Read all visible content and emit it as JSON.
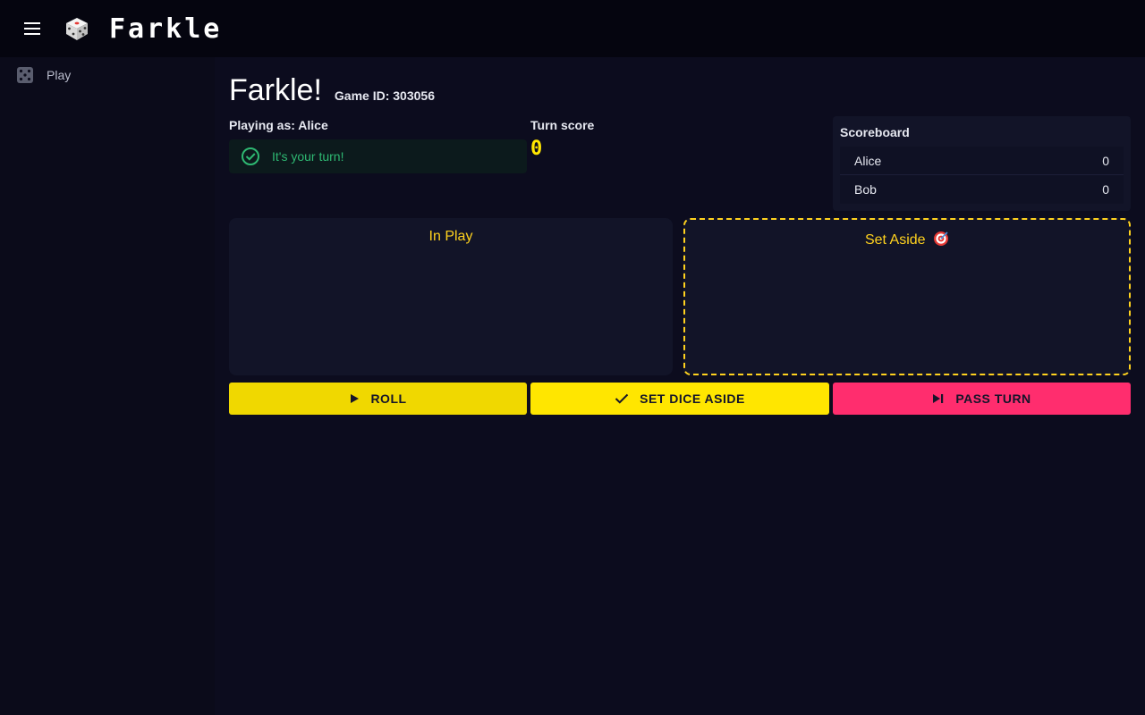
{
  "app": {
    "title": "Farkle",
    "logo_icon": "dice-icon",
    "menu_icon": "hamburger-menu-icon"
  },
  "sidebar": {
    "items": [
      {
        "label": "Play",
        "icon": "dice-five-icon"
      }
    ]
  },
  "game": {
    "title": "Farkle!",
    "game_id_label": "Game ID: 303056",
    "playing_as_prefix": "Playing as: ",
    "player_name": "Alice",
    "turn_message": "It's your turn!",
    "turn_score_label": "Turn score",
    "turn_score_value": "0"
  },
  "scoreboard": {
    "title": "Scoreboard",
    "rows": [
      {
        "name": "Alice",
        "score": "0"
      },
      {
        "name": "Bob",
        "score": "0"
      }
    ]
  },
  "zones": {
    "in_play_label": "In Play",
    "set_aside_label": "Set Aside",
    "set_aside_icon": "target-icon"
  },
  "actions": {
    "roll_label": "ROLL",
    "set_aside_label": "SET DICE ASIDE",
    "pass_label": "PASS TURN"
  },
  "colors": {
    "accent_yellow": "#ffe600",
    "accent_pink": "#ff2d6e",
    "success_green": "#2eb872",
    "background": "#0b0b1a"
  }
}
